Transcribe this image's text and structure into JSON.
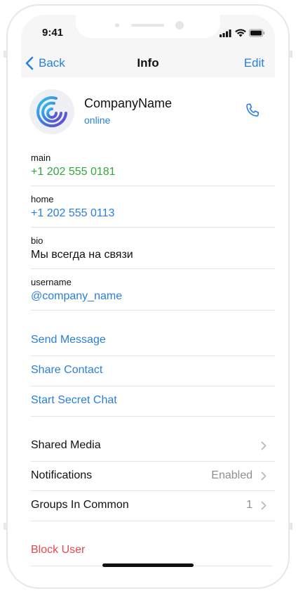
{
  "status_bar": {
    "time": "9:41"
  },
  "nav": {
    "back_label": "Back",
    "title": "Info",
    "edit_label": "Edit"
  },
  "profile": {
    "name": "CompanyName",
    "status": "online"
  },
  "fields": [
    {
      "label": "main",
      "value": "+1 202 555 0181"
    },
    {
      "label": "home",
      "value": "+1 202 555 0113"
    },
    {
      "label": "bio",
      "value": "Мы всегда на связи"
    },
    {
      "label": "username",
      "value": "@company_name"
    }
  ],
  "actions": [
    "Send Message",
    "Share Contact",
    "Start Secret Chat"
  ],
  "settings": [
    {
      "label": "Shared Media",
      "detail": ""
    },
    {
      "label": "Notifications",
      "detail": "Enabled"
    },
    {
      "label": "Groups In Common",
      "detail": "1"
    }
  ],
  "danger": {
    "block_label": "Block User"
  },
  "colors": {
    "accent": "#2a7fdb",
    "phone_main": "#31a83c",
    "destructive": "#e5484d"
  },
  "icons": [
    "chevron-left-icon",
    "phone-icon",
    "chevron-right-icon",
    "signal-icon",
    "wifi-icon",
    "battery-icon",
    "company-logo"
  ]
}
